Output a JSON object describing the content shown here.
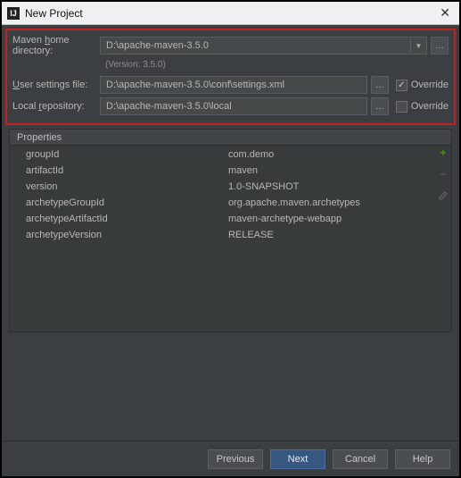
{
  "window": {
    "title": "New Project"
  },
  "maven": {
    "home_label_pre": "Maven ",
    "home_label_u": "h",
    "home_label_post": "ome directory:",
    "home_value": "D:\\apache-maven-3.5.0",
    "version_text": "(Version: 3.5.0)",
    "settings_label_pre": "",
    "settings_label_u": "U",
    "settings_label_post": "ser settings file:",
    "settings_value": "D:\\apache-maven-3.5.0\\conf\\settings.xml",
    "repo_label_pre": "Local ",
    "repo_label_u": "r",
    "repo_label_post": "epository:",
    "repo_value": "D:\\apache-maven-3.5.0\\local",
    "override_label": "Override"
  },
  "properties": {
    "header": "Properties",
    "rows": [
      {
        "key": "groupId",
        "value": "com.demo"
      },
      {
        "key": "artifactId",
        "value": "maven"
      },
      {
        "key": "version",
        "value": "1.0-SNAPSHOT"
      },
      {
        "key": "archetypeGroupId",
        "value": "org.apache.maven.archetypes"
      },
      {
        "key": "archetypeArtifactId",
        "value": "maven-archetype-webapp"
      },
      {
        "key": "archetypeVersion",
        "value": "RELEASE"
      }
    ]
  },
  "buttons": {
    "previous_pre": "",
    "previous_u": "P",
    "previous_post": "revious",
    "next_pre": "",
    "next_u": "N",
    "next_post": "ext",
    "cancel": "Cancel",
    "help": "Help"
  },
  "glyphs": {
    "dropdown": "▼",
    "ellipsis": "…",
    "plus": "+",
    "minus": "−",
    "close": "✕"
  }
}
